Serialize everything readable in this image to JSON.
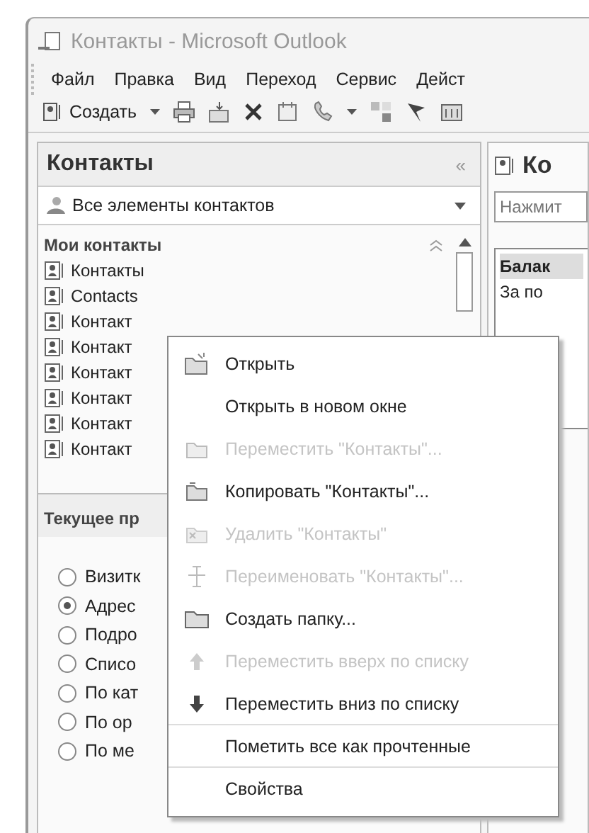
{
  "window": {
    "title": "Контакты - Microsoft Outlook"
  },
  "menu_bar": [
    "Файл",
    "Правка",
    "Вид",
    "Переход",
    "Сервис",
    "Дейст"
  ],
  "toolbar": {
    "new_button": "Создать"
  },
  "navigation_pane": {
    "title": "Контакты",
    "collapse": "«",
    "view_selector": "Все элементы контактов",
    "my_contacts": {
      "title": "Мои контакты",
      "folders": [
        {
          "name": "Контакты",
          "selected": false
        },
        {
          "name": "Contacts",
          "selected": false
        },
        {
          "name": "Контакт",
          "selected": false
        },
        {
          "name": "Контакт",
          "selected": false
        },
        {
          "name": "Контакт",
          "selected": false
        },
        {
          "name": "Контакт",
          "selected": false
        },
        {
          "name": "Контакт",
          "selected": false
        },
        {
          "name": "Контакт",
          "selected": false
        }
      ]
    },
    "current_view": {
      "title": "Текущее пр",
      "views": [
        {
          "label": "Визитк",
          "selected": false
        },
        {
          "label": "Адрес",
          "selected": true
        },
        {
          "label": "Подро",
          "selected": false
        },
        {
          "label": "Списо",
          "selected": false
        },
        {
          "label": "По кат",
          "selected": false
        },
        {
          "label": "По ор",
          "selected": false
        },
        {
          "label": "По ме",
          "selected": false
        }
      ]
    }
  },
  "content_pane": {
    "title": "Ко",
    "search_placeholder": "Нажмит",
    "group_header": "Балак",
    "row_1": "За по"
  },
  "context_menu": {
    "items": [
      {
        "label": "Открыть",
        "kind": "open",
        "disabled": false,
        "separator_after": false
      },
      {
        "label": "Открыть в новом окне",
        "kind": "plain",
        "disabled": false,
        "separator_after": false
      },
      {
        "label": "Переместить \"Контакты\"...",
        "kind": "move",
        "disabled": true,
        "separator_after": false
      },
      {
        "label": "Копировать \"Контакты\"...",
        "kind": "copy",
        "disabled": false,
        "separator_after": false
      },
      {
        "label": "Удалить \"Контакты\"",
        "kind": "delete",
        "disabled": true,
        "separator_after": false
      },
      {
        "label": "Переименовать \"Контакты\"...",
        "kind": "rename",
        "disabled": true,
        "separator_after": false
      },
      {
        "label": "Создать папку...",
        "kind": "folder",
        "disabled": false,
        "separator_after": false
      },
      {
        "label": "Переместить вверх по списку",
        "kind": "up",
        "disabled": true,
        "separator_after": false
      },
      {
        "label": "Переместить вниз по списку",
        "kind": "down",
        "disabled": false,
        "separator_after": true
      },
      {
        "label": "Пометить все как прочтенные",
        "kind": "plain",
        "disabled": false,
        "separator_after": true
      },
      {
        "label": "Свойства",
        "kind": "plain",
        "disabled": false,
        "separator_after": false
      }
    ]
  }
}
